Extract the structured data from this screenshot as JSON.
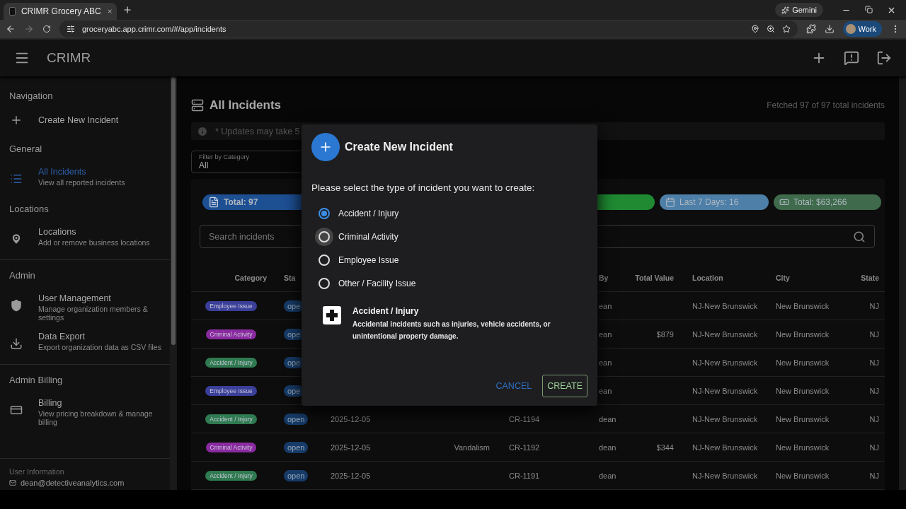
{
  "browser": {
    "tab_title": "CRIMR Grocery ABC",
    "gemini": "Gemini",
    "url": "groceryabc.app.crimr.com/#/app/incidents",
    "profile": "Work"
  },
  "app_bar": {
    "title": "CRIMR"
  },
  "sidebar": {
    "sections": [
      {
        "heading": "Navigation",
        "items": [
          {
            "label": "Create New Incident",
            "selected": false
          }
        ]
      },
      {
        "heading": "General",
        "items": [
          {
            "label": "All Incidents",
            "description": "View all reported incidents",
            "selected": true
          }
        ]
      },
      {
        "heading": "Locations",
        "items": [
          {
            "label": "Locations",
            "description": "Add or remove business locations",
            "selected": false
          }
        ]
      },
      {
        "heading": "Admin",
        "items": [
          {
            "label": "User Management",
            "description": "Manage organization members & settings",
            "selected": false
          },
          {
            "label": "Data Export",
            "description": "Export organization data as CSV files",
            "selected": false
          }
        ]
      },
      {
        "heading": "Admin Billing",
        "items": [
          {
            "label": "Billing",
            "description": "View pricing breakdown & manage billing",
            "selected": false
          }
        ]
      }
    ],
    "user_info": {
      "heading": "User Information",
      "email": "dean@detectiveanalytics.com"
    }
  },
  "page": {
    "title": "All Incidents",
    "fetched": "Fetched 97 of 97 total incidents",
    "notice": "* Updates may take 5",
    "filter": {
      "label": "Filter by Category",
      "value": "All"
    },
    "stats": [
      {
        "label": "Total: 97",
        "color": "#1d4f93"
      },
      {
        "color": "#1f8a32"
      },
      {
        "label": "Last 7 Days: 16",
        "color": "#4d7fa8"
      },
      {
        "label": "Total: $63,266",
        "color": "#3f6b4c"
      }
    ],
    "search": {
      "placeholder": "Search incidents"
    },
    "table": {
      "columns": [
        "Category",
        "Sta",
        null,
        null,
        null,
        "By",
        "Total Value",
        "Location",
        "City",
        "State"
      ],
      "rows": [
        {
          "cells": [
            {
              "label": "Employee Issue",
              "color": "#3a3f9a"
            },
            "ope",
            null,
            null,
            null,
            "ean",
            null,
            "NJ-New Brunswick",
            "New Brunswick",
            "NJ"
          ]
        },
        {
          "cells": [
            {
              "label": "Criminal Activity",
              "color": "#8a2aa0"
            },
            "ope",
            null,
            null,
            null,
            "ean",
            "$879",
            "NJ-New Brunswick",
            "New Brunswick",
            "NJ"
          ]
        },
        {
          "cells": [
            {
              "label": "Accident / Injury",
              "color": "#2f7a50"
            },
            "ope",
            null,
            null,
            null,
            "ean",
            null,
            "NJ-New Brunswick",
            "New Brunswick",
            "NJ"
          ]
        },
        {
          "cells": [
            {
              "label": "Employee Issue",
              "color": "#3a3f9a"
            },
            "ope",
            null,
            null,
            null,
            "ean",
            null,
            "NJ-New Brunswick",
            "New Brunswick",
            "NJ"
          ]
        },
        {
          "cells": [
            {
              "label": "Accident / Injury",
              "color": "#2f7a50"
            },
            "open",
            "2025-12-05",
            null,
            "CR-1194",
            "dean",
            null,
            "NJ-New Brunswick",
            "New Brunswick",
            "NJ"
          ]
        },
        {
          "cells": [
            {
              "label": "Criminal Activity",
              "color": "#8a2aa0"
            },
            "open",
            "2025-12-05",
            "Vandalism",
            "CR-1192",
            "dean",
            "$344",
            "NJ-New Brunswick",
            "New Brunswick",
            "NJ"
          ]
        },
        {
          "cells": [
            {
              "label": "Accident / Injury",
              "color": "#2f7a50"
            },
            "open",
            "2025-12-05",
            null,
            "CR-1191",
            "dean",
            null,
            "NJ-New Brunswick",
            "New Brunswick",
            "NJ"
          ]
        }
      ]
    }
  },
  "dialog": {
    "title": "Create New Incident",
    "prompt": "Please select the type of incident you want to create:",
    "options": [
      {
        "label": "Accident / Injury",
        "selected": true,
        "hovered": false
      },
      {
        "label": "Criminal Activity",
        "selected": false,
        "hovered": true
      },
      {
        "label": "Employee Issue",
        "selected": false,
        "hovered": false
      },
      {
        "label": "Other / Facility Issue",
        "selected": false,
        "hovered": false
      }
    ],
    "preview": {
      "title": "Accident / Injury",
      "description": "Accidental incidents such as injuries, vehicle accidents, or unintentional property damage."
    },
    "buttons": [
      {
        "label": "CANCEL",
        "kind": "text"
      },
      {
        "label": "CREATE",
        "kind": "outlined"
      }
    ]
  }
}
